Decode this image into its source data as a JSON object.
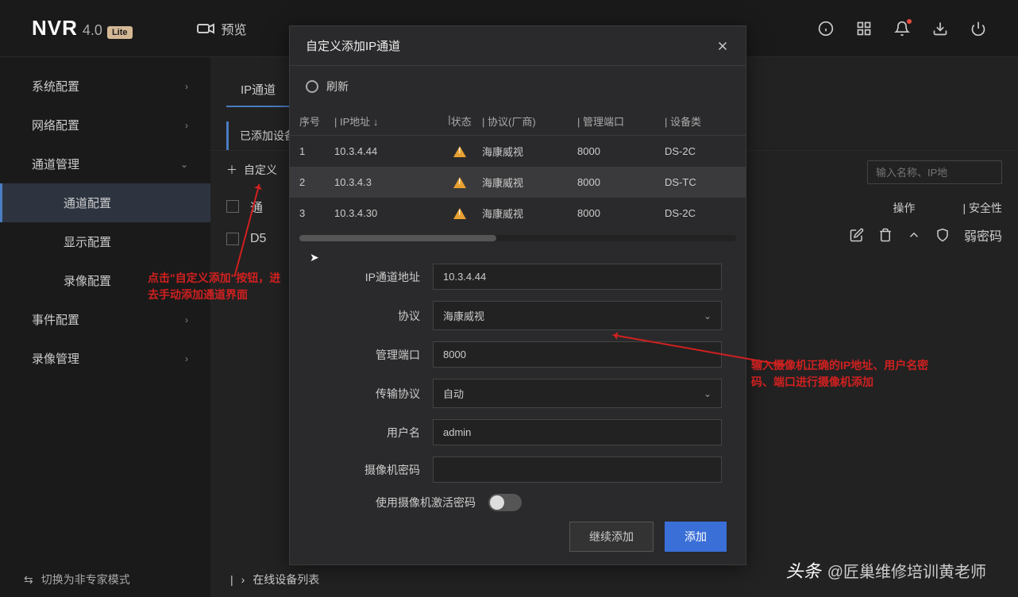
{
  "logo": {
    "name": "NVR",
    "version": "4.0",
    "badge": "Lite"
  },
  "nav": {
    "preview": "预览"
  },
  "sidebar": {
    "items": [
      {
        "label": "系统配置",
        "expand": ">"
      },
      {
        "label": "网络配置",
        "expand": ">"
      },
      {
        "label": "通道管理",
        "expand": "v"
      },
      {
        "label": "事件配置",
        "expand": ">"
      },
      {
        "label": "录像管理",
        "expand": ">"
      }
    ],
    "subs": [
      {
        "label": "通道配置"
      },
      {
        "label": "显示配置"
      },
      {
        "label": "录像配置"
      }
    ],
    "bottom": "切换为非专家模式"
  },
  "content": {
    "tab": "IP通道",
    "subtab": "已添加设备",
    "add_custom": "自定义",
    "rows": {
      "r1": "通",
      "r2": "D5"
    },
    "search_ph": "输入名称、IP地",
    "right_col1": "操作",
    "right_col2": "安全性",
    "weak_pwd": "弱密码",
    "bottom_list": "在线设备列表"
  },
  "modal": {
    "title": "自定义添加IP通道",
    "refresh": "刷新",
    "headers": {
      "no": "序号",
      "ip": "IP地址",
      "status": "状态",
      "protocol": "协议(厂商)",
      "port": "管理端口",
      "device": "设备类"
    },
    "rows": [
      {
        "no": "1",
        "ip": "10.3.4.44",
        "protocol": "海康威视",
        "port": "8000",
        "device": "DS-2C"
      },
      {
        "no": "2",
        "ip": "10.3.4.3",
        "protocol": "海康威视",
        "port": "8000",
        "device": "DS-TC"
      },
      {
        "no": "3",
        "ip": "10.3.4.30",
        "protocol": "海康威视",
        "port": "8000",
        "device": "DS-2C"
      }
    ],
    "form": {
      "ip_label": "IP通道地址",
      "ip_value": "10.3.4.44",
      "proto_label": "协议",
      "proto_value": "海康威视",
      "port_label": "管理端口",
      "port_value": "8000",
      "trans_label": "传输协议",
      "trans_value": "自动",
      "user_label": "用户名",
      "user_value": "admin",
      "pwd_label": "摄像机密码",
      "usepwd_label": "使用摄像机激活密码"
    },
    "btn_continue": "继续添加",
    "btn_add": "添加"
  },
  "anno": {
    "a1": "点击\"自定义添加\"按钮，进去手动添加通道界面",
    "a2": "输入摄像机正确的IP地址、用户名密码、端口进行摄像机添加"
  },
  "watermark": {
    "tt": "头条",
    "author": "@匠巢维修培训黄老师"
  }
}
